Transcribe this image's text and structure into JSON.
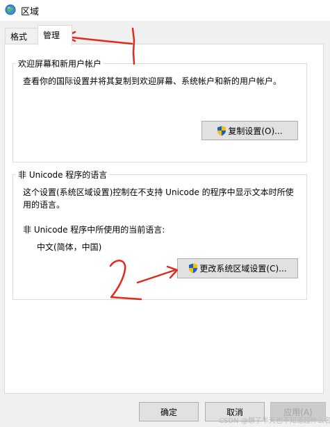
{
  "window": {
    "title": "区域"
  },
  "tabs": [
    {
      "label": "格式"
    },
    {
      "label": "管理"
    }
  ],
  "welcome": {
    "legend": "欢迎屏幕和新用户帐户",
    "description": "查看你的国际设置并将其复制到欢迎屏幕、系统帐户和新的用户帐户。",
    "copy_button": "复制设置(O)..."
  },
  "nonunicode": {
    "legend": "非 Unicode 程序的语言",
    "description_line1": "这个设置(系统区域设置)控制在不支持 Unicode 的程序中显示文本时所使",
    "description_line2": "用的语言。",
    "current_label": "非 Unicode 程序中所使用的当前语言:",
    "current_value": "中文(简体，中国)",
    "change_button": "更改系统区域设置(C)..."
  },
  "footer": {
    "ok": "确定",
    "cancel": "取消",
    "apply": "应用(A)"
  },
  "annotations": {
    "mark1": "1",
    "mark2": "2"
  },
  "watermark": "CSDN @想了半天也不知道起什么名",
  "colors": {
    "annotation": "#e5281c",
    "shield_blue": "#1c5fc4",
    "shield_yellow": "#f2c200"
  },
  "icons": [
    "globe-icon",
    "uac-shield-icon",
    "red-arrow"
  ]
}
